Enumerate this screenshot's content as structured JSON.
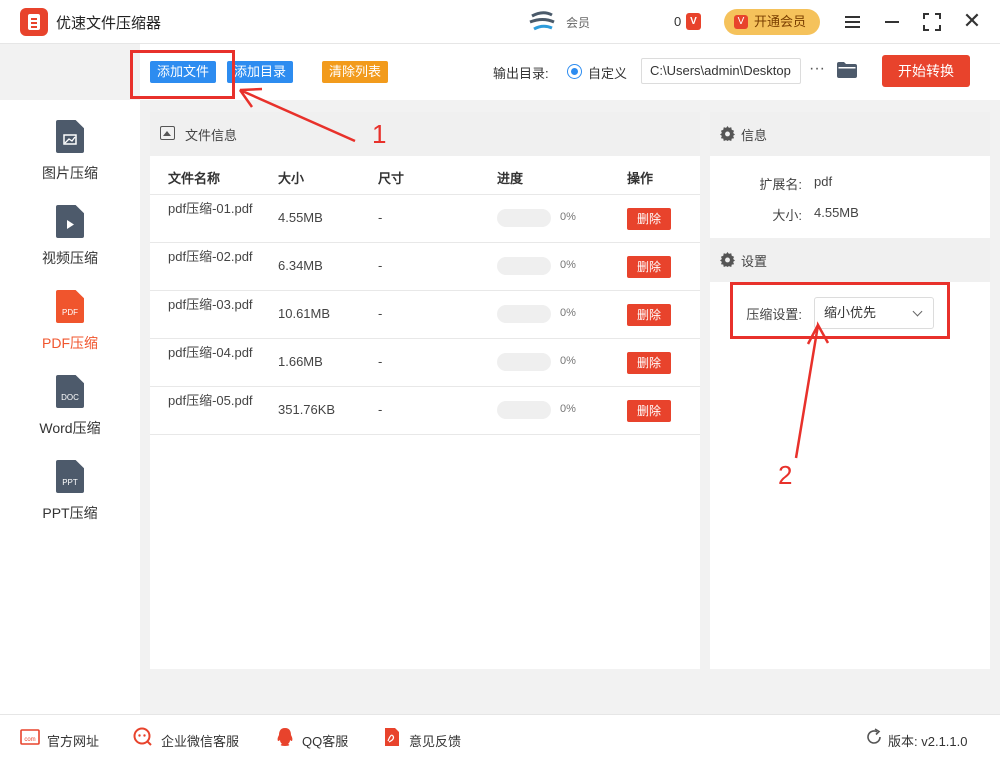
{
  "app": {
    "title": "优速文件压缩器"
  },
  "header": {
    "member_name": "会员",
    "vip_count": "0",
    "vip_badge": "V",
    "open_vip_label": "开通会员"
  },
  "toolbar": {
    "add_file": "添加文件",
    "add_dir": "添加目录",
    "clear_list": "清除列表",
    "output_label": "输出目录:",
    "custom_label": "自定义",
    "output_path": "C:\\Users\\admin\\Desktop",
    "more_label": "···",
    "start_label": "开始转换"
  },
  "sidebar": {
    "items": [
      {
        "label": "图片压缩",
        "tag": ""
      },
      {
        "label": "视频压缩",
        "tag": ""
      },
      {
        "label": "PDF压缩",
        "tag": "PDF"
      },
      {
        "label": "Word压缩",
        "tag": "DOC"
      },
      {
        "label": "PPT压缩",
        "tag": "PPT"
      }
    ],
    "active_index": 2
  },
  "file_panel": {
    "title": "文件信息",
    "columns": [
      "文件名称",
      "大小",
      "尺寸",
      "进度",
      "操作"
    ],
    "rows": [
      {
        "name": "pdf压缩-01.pdf",
        "size": "4.55MB",
        "dim": "-",
        "progress": 0,
        "pct": "0%",
        "action": "删除"
      },
      {
        "name": "pdf压缩-02.pdf",
        "size": "6.34MB",
        "dim": "-",
        "progress": 0,
        "pct": "0%",
        "action": "删除"
      },
      {
        "name": "pdf压缩-03.pdf",
        "size": "10.61MB",
        "dim": "-",
        "progress": 0,
        "pct": "0%",
        "action": "删除"
      },
      {
        "name": "pdf压缩-04.pdf",
        "size": "1.66MB",
        "dim": "-",
        "progress": 0,
        "pct": "0%",
        "action": "删除"
      },
      {
        "name": "pdf压缩-05.pdf",
        "size": "351.76KB",
        "dim": "-",
        "progress": 0,
        "pct": "0%",
        "action": "删除"
      }
    ]
  },
  "info_panel": {
    "info_title": "信息",
    "ext_label": "扩展名:",
    "ext_value": "pdf",
    "size_label": "大小:",
    "size_value": "4.55MB",
    "settings_title": "设置",
    "compress_label": "压缩设置:",
    "compress_value": "缩小优先"
  },
  "footer": {
    "site": "官方网址",
    "wechat": "企业微信客服",
    "qq": "QQ客服",
    "feedback": "意见反馈",
    "version": "版本: v2.1.1.0"
  },
  "annotations": {
    "num1": "1",
    "num2": "2"
  },
  "colors": {
    "accent_blue": "#2d8cf0",
    "accent_red": "#e8432c",
    "accent_orange": "#f29b1c",
    "annotation_red": "#e8312b"
  }
}
